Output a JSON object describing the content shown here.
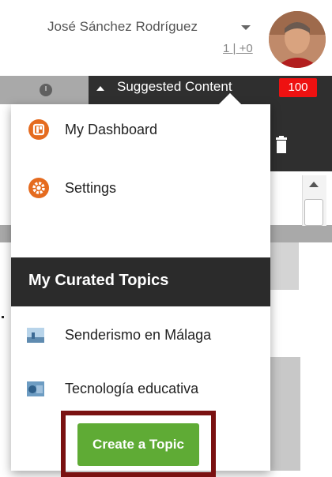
{
  "header": {
    "user_name": "José Sánchez Rodríguez",
    "stats": "1 | +0"
  },
  "topbar": {
    "suggested_label": "Suggested Content",
    "suggested_count": "100"
  },
  "menu": {
    "items": [
      {
        "label": "My Dashboard",
        "icon": "dashboard-icon"
      },
      {
        "label": "Settings",
        "icon": "gear-icon"
      }
    ]
  },
  "curated": {
    "title": "My Curated Topics",
    "topics": [
      {
        "label": "Senderismo en Málaga"
      },
      {
        "label": "Tecnología educativa"
      }
    ],
    "create_label": "Create a Topic"
  },
  "colors": {
    "accent_orange": "#e56b1f",
    "button_green": "#5fab35",
    "badge_red": "#ee1111",
    "highlight_border": "#7a1111",
    "dark_bar": "#2f2f2f"
  }
}
